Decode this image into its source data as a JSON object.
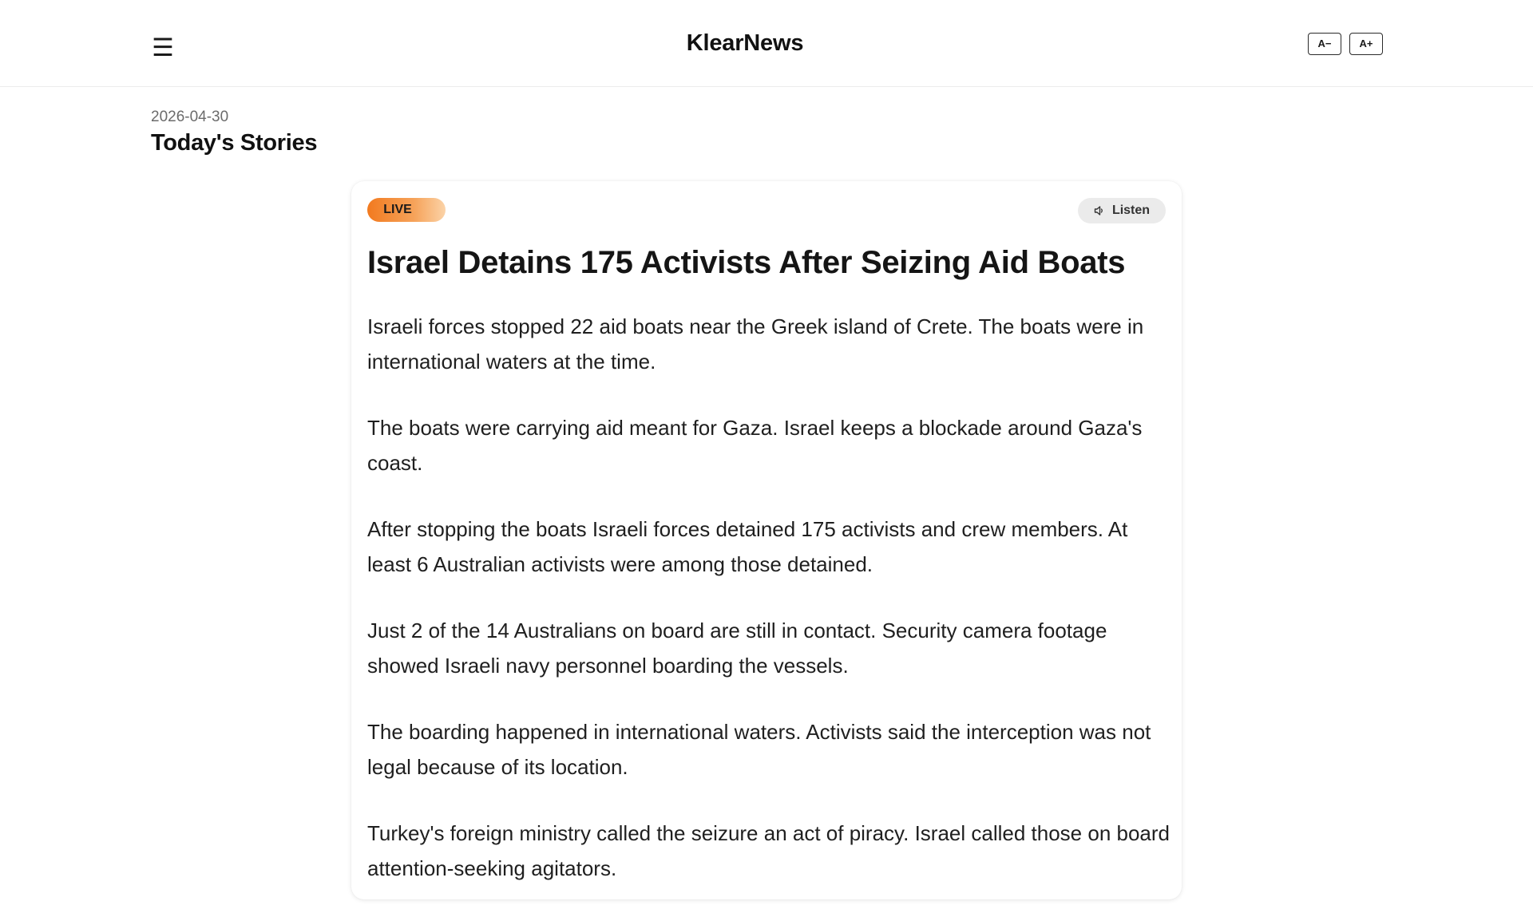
{
  "header": {
    "menu_icon": "hamburger-menu-icon",
    "brand": "KlearNews",
    "font_decrease_label": "A−",
    "font_increase_label": "A+"
  },
  "feed": {
    "date": "2026-04-30",
    "section_title": "Today's Stories"
  },
  "article": {
    "badge": "LIVE",
    "badge_gradient": [
      "#f27a1f",
      "#f6a35a",
      "#fbd3a8"
    ],
    "listen_label": "Listen",
    "listen_icon": "speaker-icon",
    "title": "Israel Detains 175 Activists After Seizing Aid Boats",
    "paragraphs": [
      "Israeli forces stopped 22 aid boats near the Greek island of Crete. The boats were in international waters at the time.",
      "The boats were carrying aid meant for Gaza. Israel keeps a blockade around Gaza's coast.",
      "After stopping the boats Israeli forces detained 175 activists and crew members. At least 6 Australian activists were among those detained.",
      "Just 2 of the 14 Australians on board are still in contact. Security camera footage showed Israeli navy personnel boarding the vessels.",
      "The boarding happened in international waters. Activists said the interception was not legal because of its location.",
      "Turkey's foreign ministry called the seizure an act of piracy. Israel called those on board attention-seeking agitators."
    ]
  }
}
